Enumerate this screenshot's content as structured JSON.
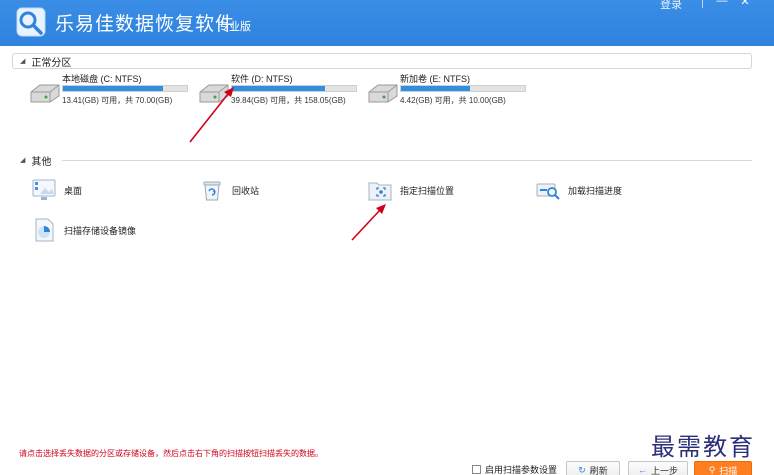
{
  "window": {
    "title": "乐易佳数据恢复软件",
    "edition": "专业版",
    "login_label": "登录",
    "minimize": "—",
    "close": "✕"
  },
  "sections": {
    "partitions_label": "正常分区",
    "other_label": "其他"
  },
  "drives": [
    {
      "name": "本地磁盘 (C: NTFS)",
      "info": "13.41(GB) 可用，共 70.00(GB)",
      "used_fraction": 0.81
    },
    {
      "name": "软件 (D: NTFS)",
      "info": "39.84(GB) 可用，共 158.05(GB)",
      "used_fraction": 0.75
    },
    {
      "name": "新加卷 (E: NTFS)",
      "info": "4.42(GB) 可用，共 10.00(GB)",
      "used_fraction": 0.56
    }
  ],
  "tiles": [
    {
      "label": "桌面",
      "icon": "desktop-icon"
    },
    {
      "label": "回收站",
      "icon": "recycle-bin-icon"
    },
    {
      "label": "指定扫描位置",
      "icon": "folder-scan-icon"
    },
    {
      "label": "加载扫描进度",
      "icon": "load-progress-icon"
    },
    {
      "label": "扫描存储设备镜像",
      "icon": "disk-image-icon"
    }
  ],
  "tip": "请点击选择丢失数据的分区或存储设备，然后点击右下角的扫描按钮扫描丢失的数据。",
  "bottom": {
    "checkbox_label": "启用扫描参数设置",
    "refresh_label": "刷新",
    "back_label": "上一步",
    "scan_label": "扫描"
  },
  "watermark": "最需教育",
  "colors": {
    "title_bar": "#2f82dd",
    "progress_fill": "#2f8fe0",
    "annotation_arrow": "#d0021b",
    "scan_button": "#ff7e1f"
  }
}
